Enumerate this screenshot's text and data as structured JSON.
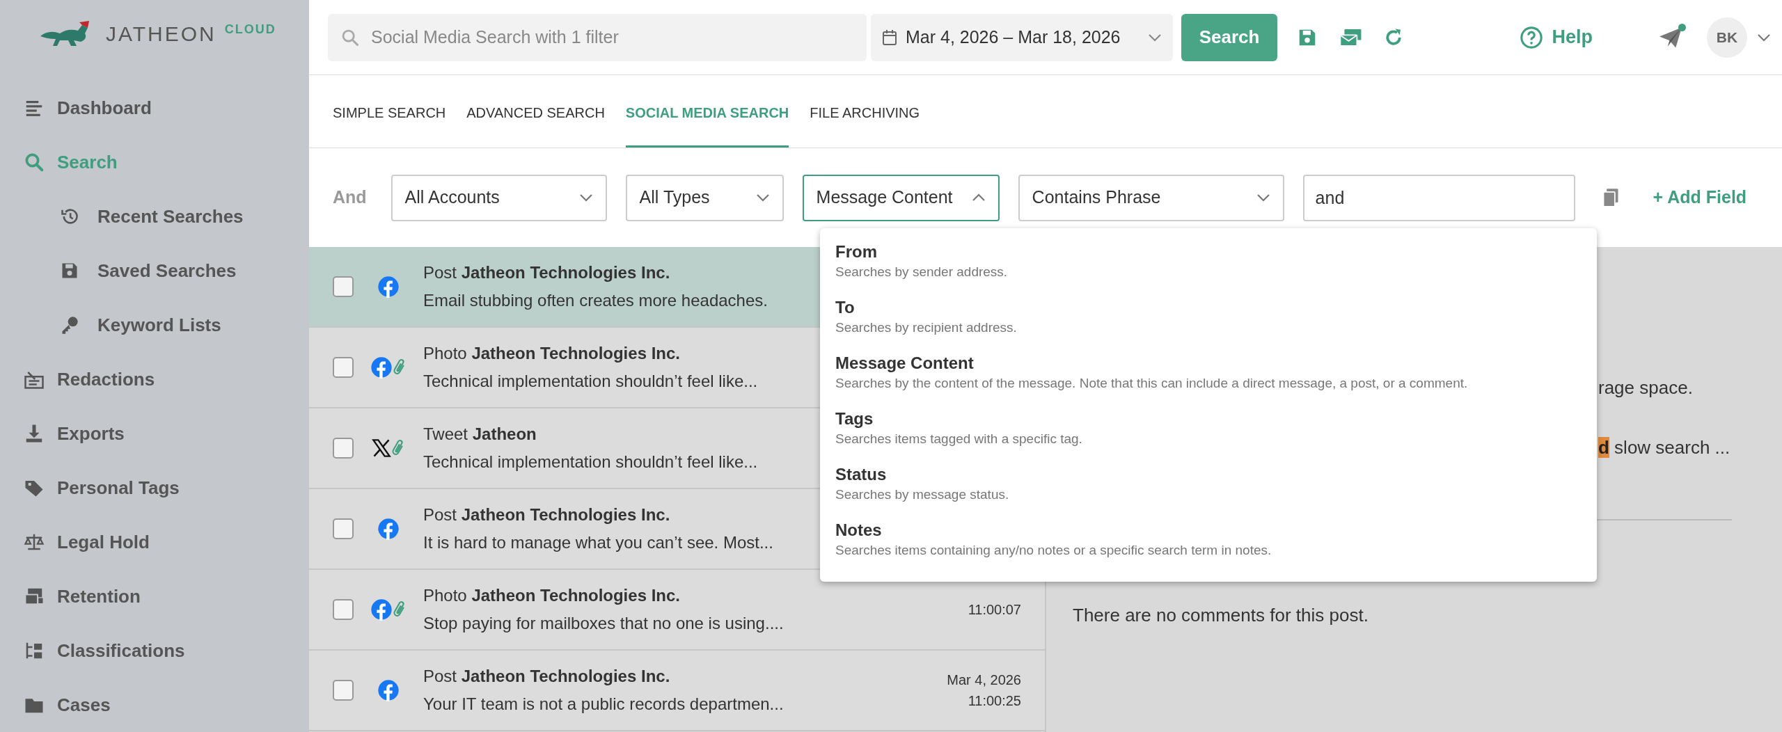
{
  "logo": {
    "name": "JATHEON",
    "suffix": "CLOUD"
  },
  "sidebar": {
    "items": [
      {
        "label": "Dashboard",
        "selected": false
      },
      {
        "label": "Search",
        "selected": true,
        "children": [
          {
            "label": "Recent Searches",
            "selected": false
          },
          {
            "label": "Saved Searches",
            "selected": false
          },
          {
            "label": "Keyword Lists",
            "selected": false
          }
        ]
      },
      {
        "label": "Redactions",
        "selected": false
      },
      {
        "label": "Exports",
        "selected": false
      },
      {
        "label": "Personal Tags",
        "selected": false
      },
      {
        "label": "Legal Hold",
        "selected": false
      },
      {
        "label": "Retention",
        "selected": false
      },
      {
        "label": "Classifications",
        "selected": false
      },
      {
        "label": "Cases",
        "selected": false
      }
    ]
  },
  "topbar": {
    "search": {
      "placeholder": "Social Media Search with 1 filter"
    },
    "date_range": "Mar 4, 2026 – Mar 18, 2026",
    "search_button": "Search",
    "help": "Help",
    "has_notification": true,
    "avatar": "BK"
  },
  "tabs": [
    {
      "label": "SIMPLE SEARCH",
      "selected": false
    },
    {
      "label": "ADVANCED SEARCH",
      "selected": false
    },
    {
      "label": "SOCIAL MEDIA SEARCH",
      "selected": true
    },
    {
      "label": "FILE ARCHIVING",
      "selected": false
    }
  ],
  "filter": {
    "conjunction": "And",
    "selects": [
      {
        "value": "All Accounts",
        "open": false
      },
      {
        "value": "All Types",
        "open": false
      },
      {
        "value": "Message Content",
        "open": true
      },
      {
        "value": "Contains Phrase",
        "open": false
      }
    ],
    "value": "and",
    "add_field": "+ Add Field"
  },
  "dropdown": {
    "options": [
      {
        "title": "From",
        "description": "Searches by sender address."
      },
      {
        "title": "To",
        "description": "Searches by recipient address."
      },
      {
        "title": "Message Content",
        "description": "Searches by the content of the message. Note that this can include a direct message, a post, or a comment."
      },
      {
        "title": "Tags",
        "description": "Searches items tagged with a specific tag."
      },
      {
        "title": "Status",
        "description": "Searches by message status."
      },
      {
        "title": "Notes",
        "description": "Searches items containing any/no notes or a specific search term in notes."
      }
    ]
  },
  "rows": [
    {
      "type": "Post",
      "author": "Jatheon Technologies Inc.",
      "text": "Email stubbing often creates more headaches.",
      "kind": "facebook",
      "attachment": false,
      "checked": false,
      "selected": true
    },
    {
      "type": "Photo",
      "author": "Jatheon Technologies Inc.",
      "text": "Technical implementation shouldn’t feel like...",
      "kind": "facebook",
      "attachment": true,
      "checked": false,
      "selected": false
    },
    {
      "type": "Tweet",
      "author": "Jatheon",
      "text": "Technical implementation shouldn’t feel like...",
      "kind": "x",
      "attachment": true,
      "checked": false,
      "selected": false
    },
    {
      "type": "Post",
      "author": "Jatheon Technologies Inc.",
      "text": "It is hard to manage what you can’t see. Most...",
      "kind": "facebook",
      "attachment": false,
      "checked": false,
      "selected": false
    },
    {
      "type": "Photo",
      "author": "Jatheon Technologies Inc.",
      "text": "Stop paying for mailboxes that no one is using....",
      "kind": "facebook",
      "attachment": true,
      "checked": false,
      "selected": false,
      "time": "11:00:07"
    },
    {
      "type": "Post",
      "author": "Jatheon Technologies Inc.",
      "text": "Your IT team is not a public records departmen...",
      "kind": "facebook",
      "attachment": false,
      "checked": false,
      "selected": false,
      "date": "Mar 4, 2026",
      "time": "11:00:25"
    }
  ],
  "detail": {
    "lines": [
      {
        "text": "rage space."
      },
      {
        "highlight": "d",
        "text": " slow search ..."
      }
    ],
    "no_comments": "There are no comments for this post."
  }
}
